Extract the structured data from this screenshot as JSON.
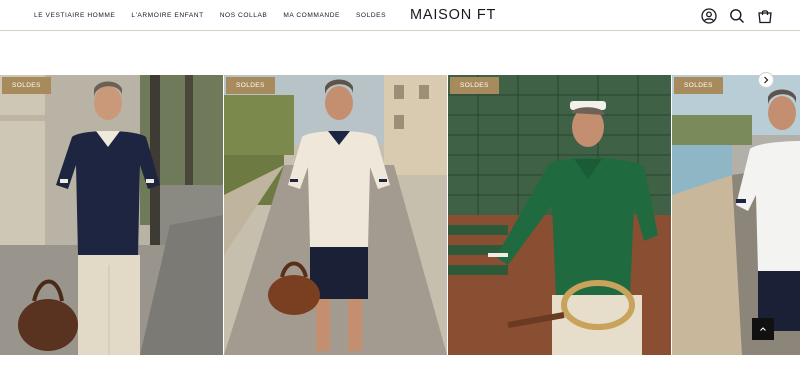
{
  "header": {
    "nav": [
      {
        "label": "LE VESTIAIRE HOMME"
      },
      {
        "label": "L'ARMOIRE ENFANT"
      },
      {
        "label": "NOS COLLAB"
      },
      {
        "label": "MA COMMANDE"
      },
      {
        "label": "SOLDES"
      }
    ],
    "logo": "MAISON FT",
    "icons": [
      "account-icon",
      "search-icon",
      "cart-icon"
    ]
  },
  "carousel": {
    "slides": [
      {
        "badge": "SOLDES",
        "alt": "navy-polo-street"
      },
      {
        "badge": "SOLDES",
        "alt": "cream-polo-street"
      },
      {
        "badge": "SOLDES",
        "alt": "green-polo-tennis"
      },
      {
        "badge": "SOLDES",
        "alt": "white-polo-seaside"
      }
    ],
    "next_icon": "chevron-right-icon",
    "scroll_top_icon": "chevron-up-icon"
  },
  "colors": {
    "badge": "#a88b5d",
    "header_border": "#d9cfc2",
    "text": "#1a1a1a"
  }
}
